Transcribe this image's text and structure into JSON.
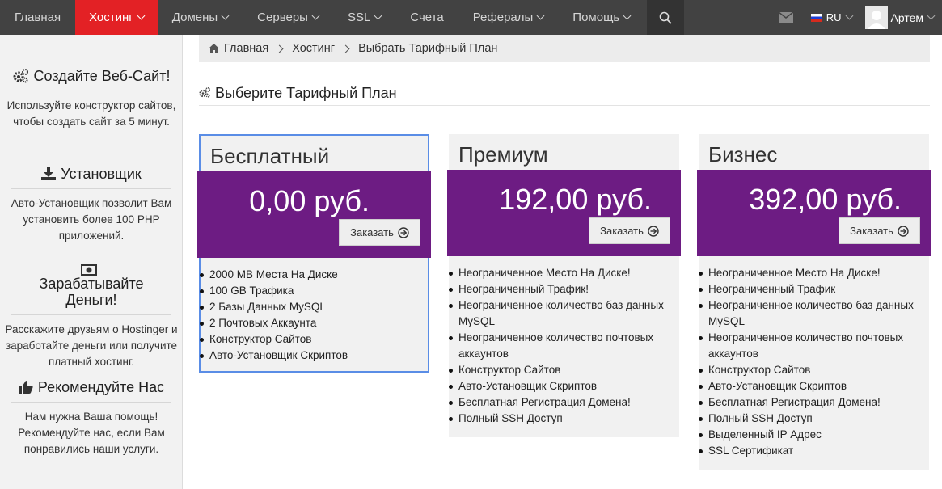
{
  "nav": {
    "items": [
      {
        "label": "Главная",
        "dropdown": false,
        "active": false
      },
      {
        "label": "Хостинг",
        "dropdown": true,
        "active": true
      },
      {
        "label": "Домены",
        "dropdown": true,
        "active": false
      },
      {
        "label": "Серверы",
        "dropdown": true,
        "active": false
      },
      {
        "label": "SSL",
        "dropdown": true,
        "active": false
      },
      {
        "label": "Счета",
        "dropdown": false,
        "active": false
      },
      {
        "label": "Рефералы",
        "dropdown": true,
        "active": false
      },
      {
        "label": "Помощь",
        "dropdown": true,
        "active": false
      }
    ],
    "lang": "RU",
    "user_name": "Артем"
  },
  "sidebar": {
    "blocks": [
      {
        "title": "Создайте Веб-Сайт!",
        "icon": "gears-icon",
        "text": "Используйте конструктор сайтов, чтобы создать сайт за 5 минут."
      },
      {
        "title": "Установщик",
        "icon": "download-icon",
        "text": "Авто-Установщик позволит Вам установить более 100 PHP приложений."
      },
      {
        "title": "Зарабатывайте Деньги!",
        "icon": "money-icon",
        "text": "Расскажите друзьям о Hostinger и заработайте деньги или получите платный хостинг."
      },
      {
        "title": "Рекомендуйте Нас",
        "icon": "thumbs-up-icon",
        "text": "Нам нужна Ваша помощь! Рекомендуйте нас, если Вам понравились наши услуги."
      }
    ]
  },
  "breadcrumb": {
    "items": [
      "Главная",
      "Хостинг",
      "Выбрать Тарифный План"
    ]
  },
  "page_title": "Выберите Тарифный План",
  "plans": [
    {
      "name": "Бесплатный",
      "price": "0,00 руб.",
      "order_label": "Заказать",
      "selected": true,
      "features": [
        "2000 MB Места На Диске",
        "100 GB Трафика",
        "2 Базы Данных MySQL",
        "2 Почтовых Аккаунта",
        "Конструктор Сайтов",
        "Авто-Установщик Скриптов"
      ]
    },
    {
      "name": "Премиум",
      "price": "192,00 руб.",
      "order_label": "Заказать",
      "selected": false,
      "features": [
        "Неограниченное Место На Диске!",
        "Неограниченный Трафик!",
        "Неограниченное количество баз данных MySQL",
        "Неограниченное количество почтовых аккаунтов",
        "Конструктор Сайтов",
        "Авто-Установщик Скриптов",
        "Бесплатная Регистрация Домена!",
        "Полный SSH Доступ"
      ]
    },
    {
      "name": "Бизнес",
      "price": "392,00 руб.",
      "order_label": "Заказать",
      "selected": false,
      "features": [
        "Неограниченное Место На Диске!",
        "Неограниченный Трафик",
        "Неограниченное количество баз данных MySQL",
        "Неограниченное количество почтовых аккаунтов",
        "Конструктор Сайтов",
        "Авто-Установщик Скриптов",
        "Бесплатная Регистрация Домена!",
        "Полный SSH Доступ",
        "Выделенный IP Адрес",
        "SSL Сертификат"
      ]
    }
  ],
  "colors": {
    "nav_bg": "#424242",
    "nav_active": "#e32125",
    "plan_band": "#6d1c83",
    "selected_border": "#5a8de6"
  }
}
